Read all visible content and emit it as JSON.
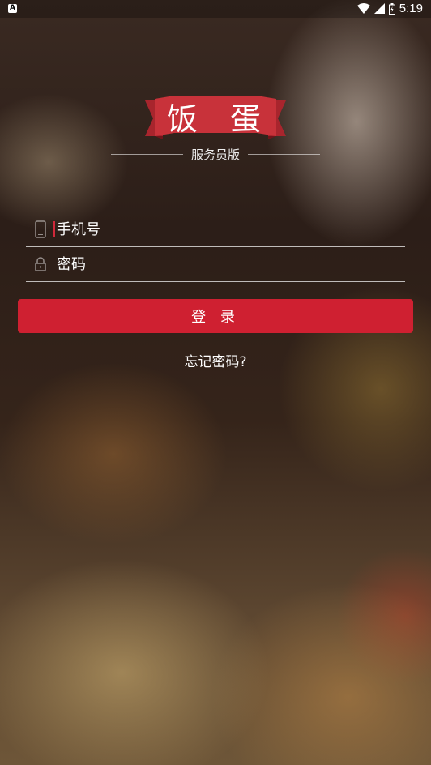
{
  "status_bar": {
    "time": "5:19",
    "left_icon": "A"
  },
  "brand": {
    "name": "饭 蛋",
    "subtitle": "服务员版"
  },
  "form": {
    "phone_placeholder": "手机号",
    "password_placeholder": "密码",
    "login_label": "登 录",
    "forgot_label": "忘记密码?"
  },
  "colors": {
    "accent": "#cf2031",
    "ribbon": "#c8323a"
  },
  "icons": {
    "phone": "phone-icon",
    "lock": "lock-icon",
    "wifi": "wifi-icon",
    "signal": "signal-icon",
    "battery": "battery-icon"
  }
}
